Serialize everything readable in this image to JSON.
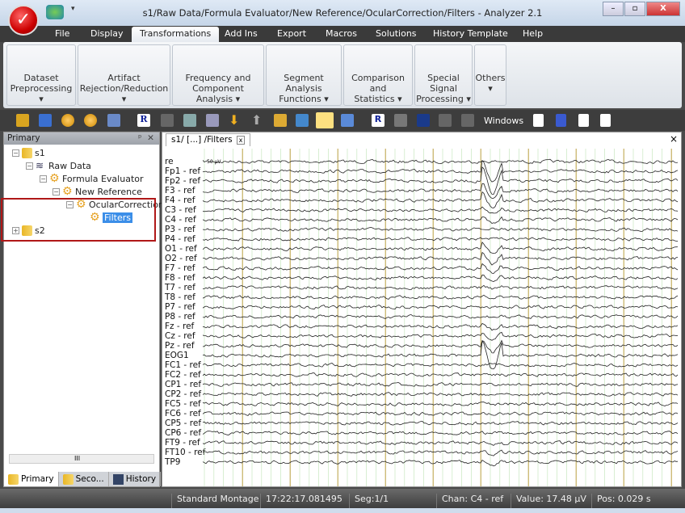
{
  "window": {
    "title": "s1/Raw Data/Formula Evaluator/New Reference/OcularCorrection/Filters - Analyzer 2.1",
    "minimize": "–",
    "maximize": "▫",
    "close": "X"
  },
  "menu": [
    "File",
    "Display",
    "Transformations",
    "Add Ins",
    "Export",
    "Macros",
    "Solutions",
    "History Template",
    "Help"
  ],
  "menu_active": "Transformations",
  "ribbon": [
    {
      "l1": "Dataset",
      "l2": "Preprocessing ▾"
    },
    {
      "l1": "Artifact",
      "l2": "Rejection/Reduction ▾"
    },
    {
      "l1": "Frequency and",
      "l2": "Component Analysis ▾"
    },
    {
      "l1": "Segment Analysis",
      "l2": "Functions ▾"
    },
    {
      "l1": "Comparison and",
      "l2": "Statistics ▾"
    },
    {
      "l1": "Special Signal",
      "l2": "Processing ▾"
    },
    {
      "l1": "Others",
      "l2": "▾"
    }
  ],
  "toolbar": {
    "windows_label": "Windows"
  },
  "left_panel": {
    "title": "Primary",
    "pin": "ᵖ",
    "close": "✕",
    "tree": {
      "s1": "s1",
      "raw": "Raw Data",
      "formula": "Formula Evaluator",
      "newref": "New Reference",
      "ocular": "OcularCorrection",
      "filters": "Filters",
      "s2": "s2"
    },
    "scroll_thumb": "III",
    "tabs": [
      "Primary",
      "Seco...",
      "History"
    ]
  },
  "document": {
    "tab": "s1/ [...] /Filters",
    "tab_close": "x",
    "close": "×",
    "scale_label": "50 µV",
    "channels": [
      "re",
      "Fp1 - ref",
      "Fp2 - ref",
      "F3 - ref",
      "F4 - ref",
      "C3 - ref",
      "C4 - ref",
      "P3 - ref",
      "P4 - ref",
      "O1 - ref",
      "O2 - ref",
      "F7 - ref",
      "F8 - ref",
      "T7 - ref",
      "T8 - ref",
      "P7 - ref",
      "P8 - ref",
      "Fz - ref",
      "Cz - ref",
      "Pz - ref",
      "EOG1",
      "FC1 - ref",
      "FC2 - ref",
      "CP1 - ref",
      "CP2 - ref",
      "FC5 - ref",
      "FC6 - ref",
      "CP5 - ref",
      "CP6 - ref",
      "FT9 - ref",
      "FT10 - ref",
      "TP9"
    ]
  },
  "status": {
    "montage": "Standard Montage",
    "time": "17:22:17.081495",
    "seg": "Seg:1/1",
    "chan": "Chan:  C4 - ref",
    "value": "Value: 17.48 µV",
    "pos": "Pos:  0.029 s"
  },
  "colors": {
    "major_grid": "#b8a040",
    "minor_grid": "#c8e8c0",
    "trace": "#222222",
    "selection": "#b01818"
  }
}
